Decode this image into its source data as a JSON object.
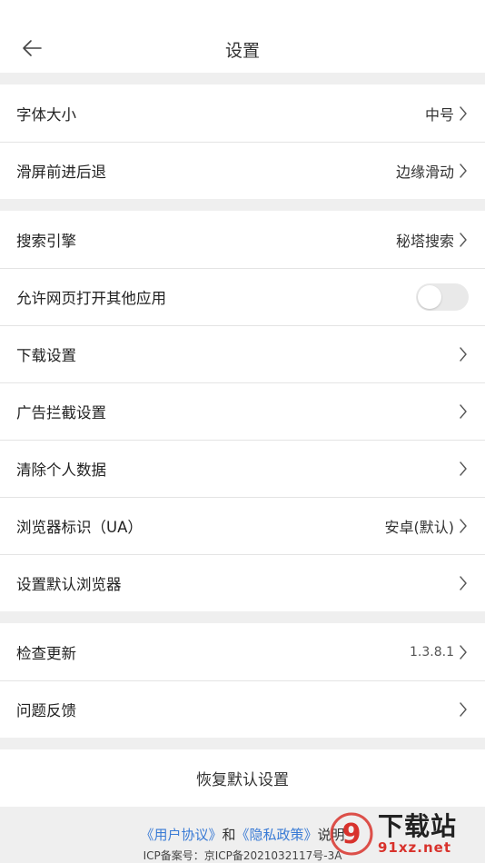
{
  "header": {
    "title": "设置"
  },
  "groups": [
    [
      {
        "label": "字体大小",
        "value": "中号"
      },
      {
        "label": "滑屏前进后退",
        "value": "边缘滑动"
      }
    ],
    [
      {
        "label": "搜索引擎",
        "value": "秘塔搜索"
      },
      {
        "label": "允许网页打开其他应用",
        "toggle": false
      },
      {
        "label": "下载设置"
      },
      {
        "label": "广告拦截设置"
      },
      {
        "label": "清除个人数据"
      },
      {
        "label": "浏览器标识（UA）",
        "value": "安卓(默认)"
      },
      {
        "label": "设置默认浏览器"
      }
    ],
    [
      {
        "label": "检查更新",
        "value": "1.3.8.1"
      },
      {
        "label": "问题反馈"
      }
    ]
  ],
  "reset_label": "恢复默认设置",
  "footer": {
    "user_agreement": "《用户协议》",
    "and": "和",
    "privacy_policy": "《隐私政策》",
    "explain": "说明",
    "icp": "ICP备案号：京ICP备2021032117号-3A"
  },
  "watermark": {
    "main": "下载站",
    "sub": "91xz.net",
    "badge_text": "9",
    "accent": "#d8322c"
  },
  "colors": {
    "link": "#3a7bd5",
    "background": "#efefef",
    "toggle_off": "#e9e9e9"
  }
}
